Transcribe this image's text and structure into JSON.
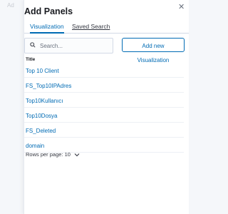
{
  "background": {
    "ghost_text": "Ad"
  },
  "panel": {
    "title": "Add Panels",
    "close_icon": "close-icon",
    "tabs": [
      {
        "label": "Visualization",
        "active": true
      },
      {
        "label": "Saved Search",
        "active": false
      }
    ],
    "search": {
      "placeholder": "Search...",
      "value": "",
      "icon": "search-icon"
    },
    "add_button": "Add new Visualization",
    "table": {
      "header": "Title",
      "rows": [
        "Top 10 Client",
        "FS_Top10IPAdres",
        "Top10Kullanıcı",
        "Top10Dosya",
        "FS_Deleted",
        "domain"
      ]
    },
    "pagination": {
      "label": "Rows per page: 10",
      "icon": "chevron-down-icon"
    }
  },
  "colors": {
    "accent": "#006bb4",
    "text": "#343741",
    "border": "#d3dae6"
  }
}
